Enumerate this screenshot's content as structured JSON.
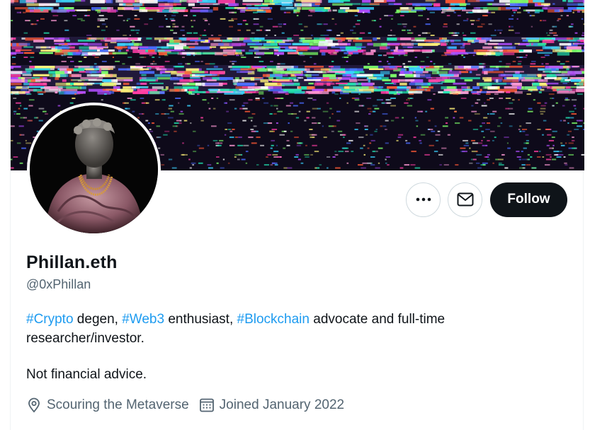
{
  "profile": {
    "display_name": "Phillan.eth",
    "handle": "@0xPhillan",
    "bio": {
      "tag1": "#Crypto",
      "text1": " degen, ",
      "tag2": "#Web3",
      "text2": " enthusiast, ",
      "tag3": "#Blockchain",
      "text3": " advocate and full-time researcher/investor.",
      "line2": "Not financial advice."
    },
    "location": "Scouring the Metaverse",
    "joined": "Joined January 2022"
  },
  "actions": {
    "follow_label": "Follow",
    "more_icon": "more-dots-icon",
    "message_icon": "envelope-icon"
  },
  "colors": {
    "accent": "#1d9bf0",
    "follow_bg": "#0f1419",
    "muted_text": "#536471",
    "border": "#cfd9de"
  }
}
